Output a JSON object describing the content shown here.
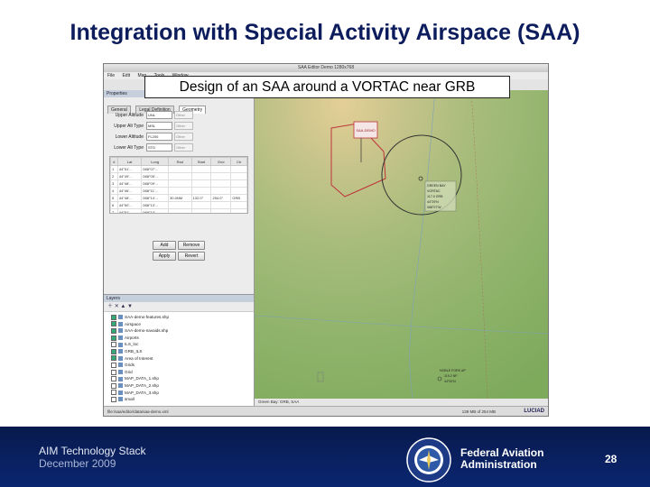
{
  "slide": {
    "title": "Integration with Special Activity Airspace (SAA)",
    "callout": "Design of an SAA around a VORTAC near GRB"
  },
  "app": {
    "window_title": "SAA Editor Demo 1280x768",
    "menu": [
      "File",
      "Edit",
      "Map",
      "Tools",
      "Window"
    ],
    "panel_header": "Properties",
    "tabs": [
      "General",
      "Legal Definition",
      "Geometry"
    ],
    "form": [
      {
        "label": "Upper Altitude",
        "value": "UNL",
        "unit": "Other"
      },
      {
        "label": "Upper Alt Type",
        "value": "MSL",
        "unit": "Other"
      },
      {
        "label": "Lower Altitude",
        "value": "FL200",
        "unit": "Other"
      },
      {
        "label": "Lower Alt Type",
        "value": "STD",
        "unit": "Other"
      }
    ],
    "table_columns": [
      "#",
      "Lat",
      "Long",
      "Rad",
      "Start",
      "End",
      "Ctr"
    ],
    "table_rows": [
      [
        "1",
        "44°51'...",
        "088°07'...",
        "",
        "",
        "",
        ""
      ],
      [
        "2",
        "44°49'...",
        "088°05'...",
        "",
        "",
        "",
        ""
      ],
      [
        "3",
        "44°48'...",
        "088°09'...",
        "",
        "",
        "",
        ""
      ],
      [
        "4",
        "44°46'...",
        "088°11'...",
        "",
        "",
        "",
        ""
      ],
      [
        "5",
        "44°48'...",
        "088°14'...",
        "30.0NM",
        "132.0°",
        "254.0°",
        "GRB"
      ],
      [
        "6",
        "44°50'...",
        "088°13'...",
        "",
        "",
        "",
        ""
      ],
      [
        "7",
        "44°51'...",
        "088°10'...",
        "",
        "",
        "",
        ""
      ]
    ],
    "buttons": {
      "add": "Add",
      "remove": "Remove",
      "apply": "Apply",
      "revert": "Revert"
    },
    "layer_panel_header": "Layers",
    "layers": [
      {
        "name": "SAA-demo-features.shp",
        "checked": true
      },
      {
        "name": "Airspace",
        "checked": true
      },
      {
        "name": "SAA-demo-navaids.shp",
        "checked": true
      },
      {
        "name": "Airports",
        "checked": true
      },
      {
        "name": "ILS_loc",
        "checked": false
      },
      {
        "name": "GRB_ILS",
        "checked": true
      },
      {
        "name": "Area of Interest",
        "checked": true
      },
      {
        "name": "Grids",
        "checked": false
      },
      {
        "name": "Grid",
        "checked": false
      },
      {
        "name": "MAP_DATA_1.shp",
        "checked": false
      },
      {
        "name": "MAP_DATA_2.shp",
        "checked": false
      },
      {
        "name": "MAP_DATA_3.shp",
        "checked": false
      },
      {
        "name": "small",
        "checked": false
      }
    ],
    "map": {
      "saa_label": "SAA-DEMO",
      "vortac_label": [
        "GREEN BAY",
        "VORTAC",
        "117.0 GRB",
        "44°29'N",
        "088°07'W"
      ],
      "airport_label": [
        "NOBLE FORK AP",
        "119.2 NF",
        "44°00'N"
      ]
    },
    "map_status": "Green Bay: GRB, SAA",
    "status_left": "file:/saa/editor/data/saa-demo.xml",
    "status_right": "139 MB of 254 MB",
    "vendor_logo": "LUCIAD"
  },
  "footer": {
    "line1": "AIM Technology Stack",
    "line2": "December 2009",
    "org_line1": "Federal Aviation",
    "org_line2": "Administration",
    "page_number": "28"
  },
  "colors": {
    "title": "#0c1c5c",
    "footer_bg": "#0b2670",
    "saa_outline": "#c0333a",
    "circle": "#333333"
  }
}
